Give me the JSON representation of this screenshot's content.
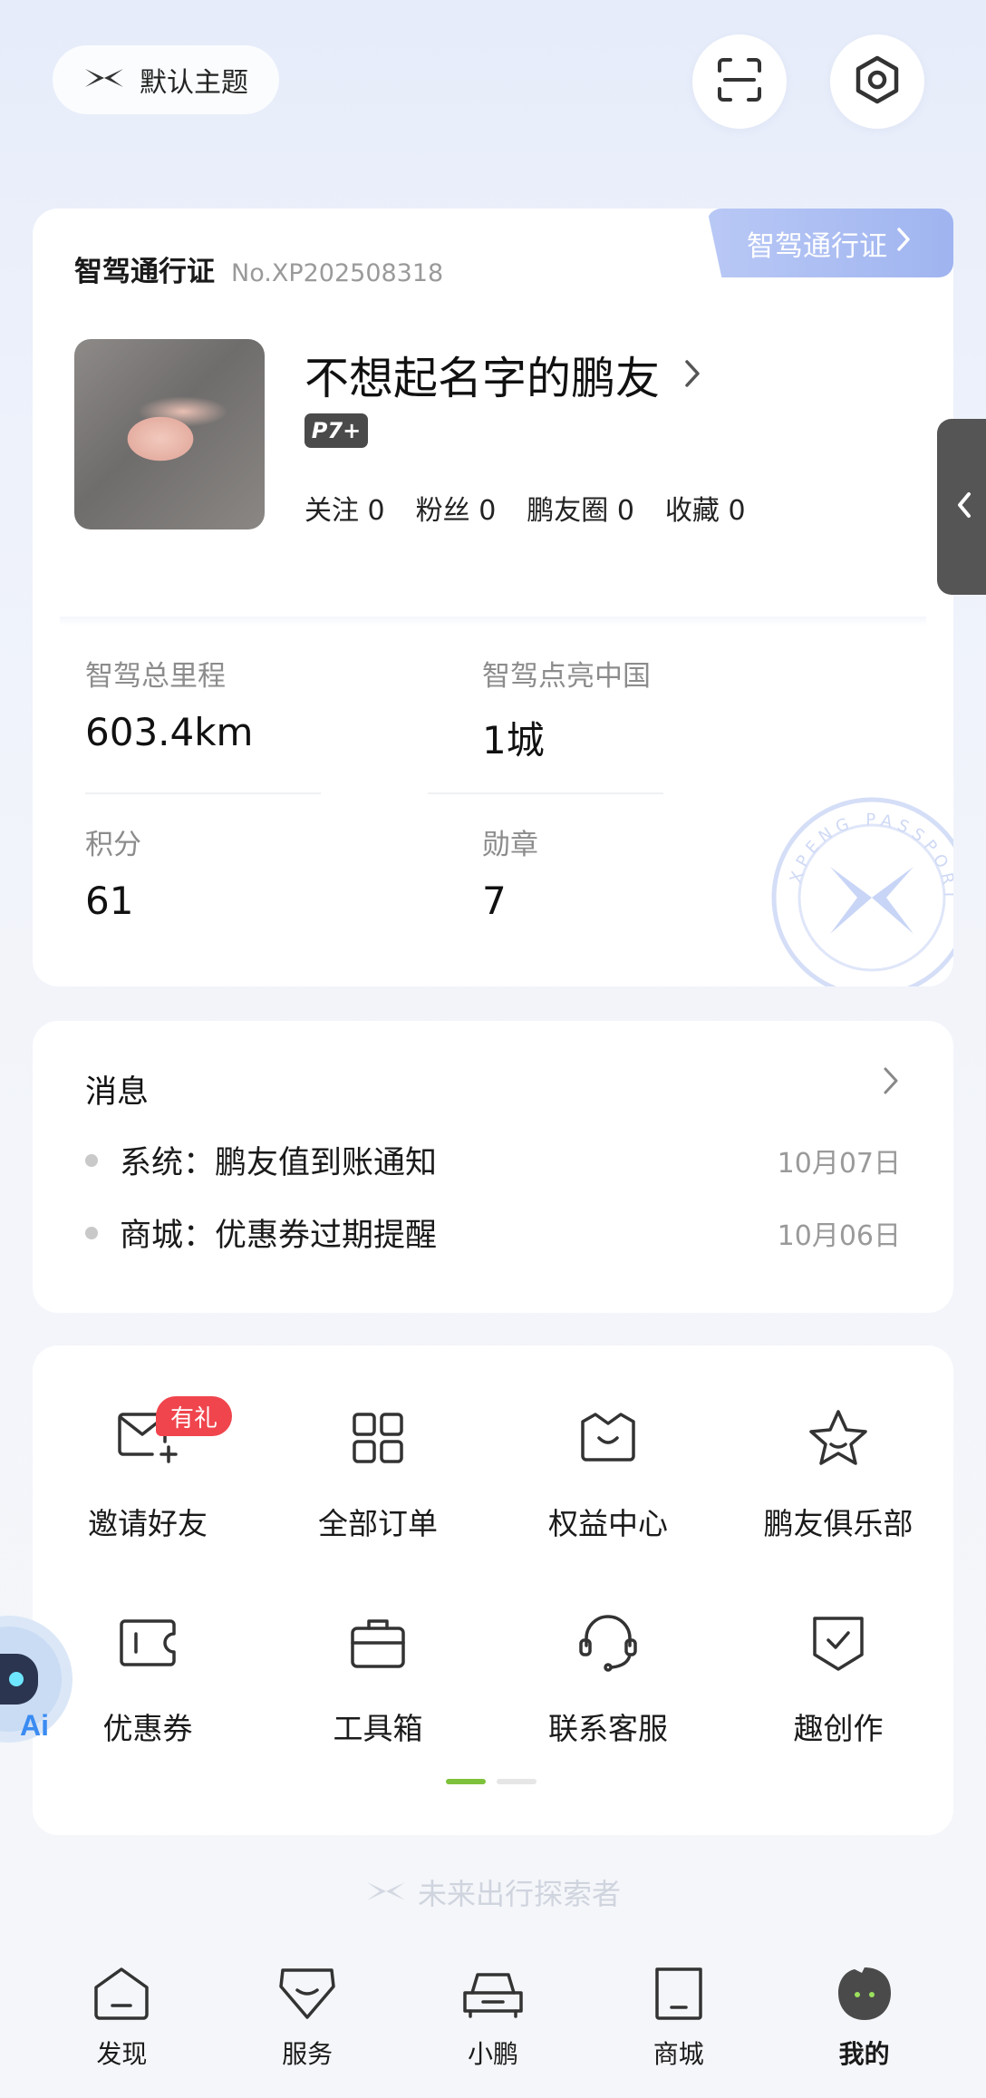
{
  "header": {
    "theme_label": "默认主题",
    "scan_icon": "scan-icon",
    "settings_icon": "settings-icon"
  },
  "passport": {
    "tab_label": "智驾通行证",
    "title": "智驾通行证",
    "number": "No.XP202508318",
    "nickname": "不想起名字的鹏友",
    "car_model": "P7+",
    "social": [
      {
        "label": "关注",
        "count": "0"
      },
      {
        "label": "粉丝",
        "count": "0"
      },
      {
        "label": "鹏友圈",
        "count": "0"
      },
      {
        "label": "收藏",
        "count": "0"
      }
    ],
    "stats": [
      {
        "label": "智驾总里程",
        "value": "603.4km"
      },
      {
        "label": "智驾点亮中国",
        "value": "1城"
      },
      {
        "label": "积分",
        "value": "61"
      },
      {
        "label": "勋章",
        "value": "7"
      }
    ],
    "stamp_text": "XPENG PASSPORT"
  },
  "messages": {
    "title": "消息",
    "items": [
      {
        "text": "系统：鹏友值到账通知",
        "date": "10月07日"
      },
      {
        "text": "商城：优惠券过期提醒",
        "date": "10月06日"
      }
    ]
  },
  "services": {
    "gift_badge": "有礼",
    "items": [
      {
        "label": "邀请好友",
        "icon": "invite-mail-icon"
      },
      {
        "label": "全部订单",
        "icon": "orders-grid-icon"
      },
      {
        "label": "权益中心",
        "icon": "benefits-crown-icon"
      },
      {
        "label": "鹏友俱乐部",
        "icon": "club-star-icon"
      },
      {
        "label": "优惠券",
        "icon": "coupon-icon"
      },
      {
        "label": "工具箱",
        "icon": "toolbox-icon"
      },
      {
        "label": "联系客服",
        "icon": "customer-service-icon"
      },
      {
        "label": "趣创作",
        "icon": "creation-shield-icon"
      }
    ],
    "pager_active": 0,
    "pager_count": 2
  },
  "ai_badge": "Ai",
  "slogan": "未来出行探索者",
  "nav": [
    {
      "label": "发现",
      "icon": "discover-icon",
      "active": false
    },
    {
      "label": "服务",
      "icon": "service-icon",
      "active": false
    },
    {
      "label": "小鹏",
      "icon": "car-icon",
      "active": false
    },
    {
      "label": "商城",
      "icon": "mall-icon",
      "active": false
    },
    {
      "label": "我的",
      "icon": "profile-avatar-icon",
      "active": true
    }
  ],
  "colors": {
    "accent_green": "#7ec23b",
    "gift_red": "#f0454d",
    "passport_tab": "#a9bcf2"
  }
}
